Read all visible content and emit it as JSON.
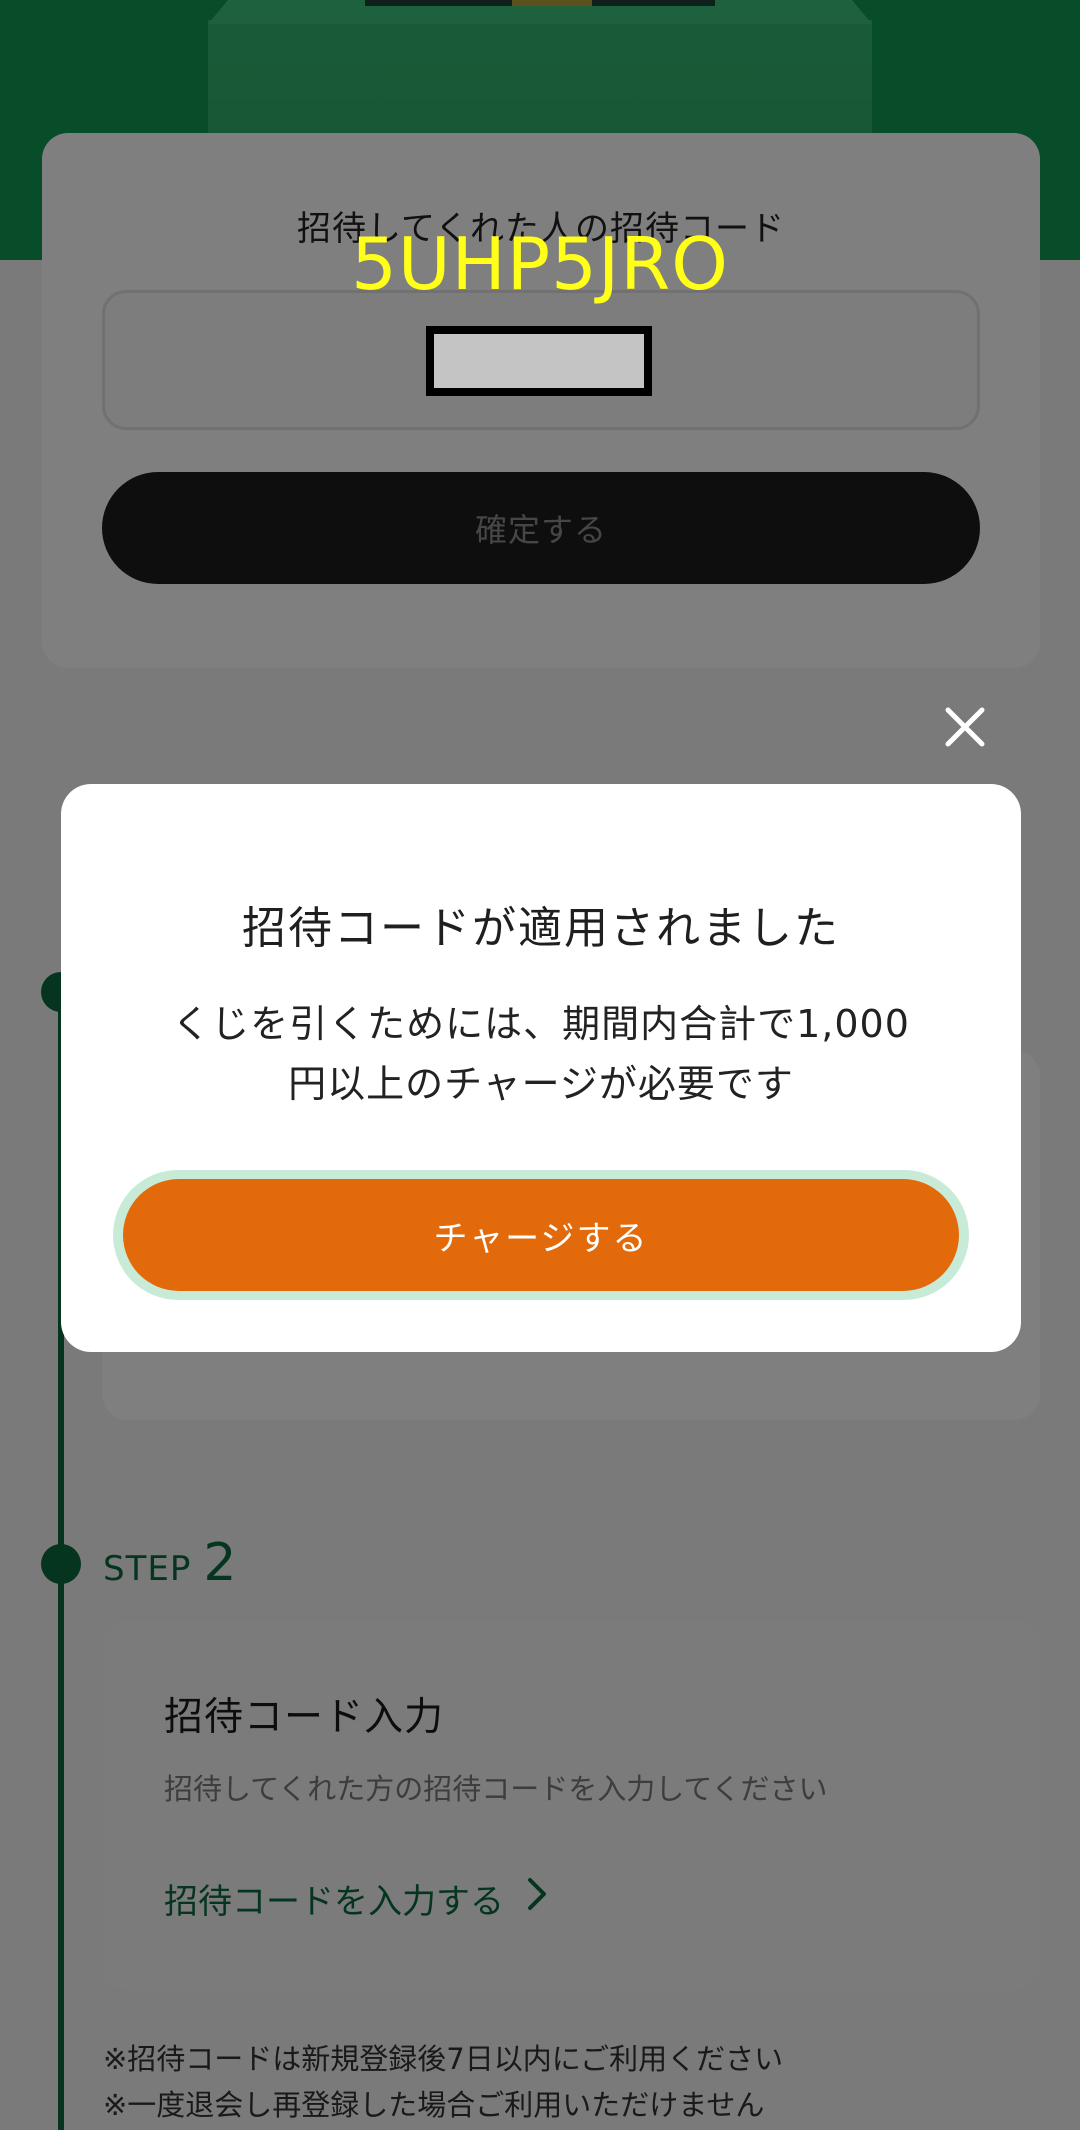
{
  "annotation": {
    "code_text": "5UHP5JRO"
  },
  "referral_section": {
    "label": "招待してくれた人の招待コード",
    "confirm_label": "確定する"
  },
  "step2": {
    "step_word": "STEP",
    "step_number": "2",
    "title": "招待コード入力",
    "description": "招待してくれた方の招待コードを入力してください",
    "link_label": "招待コードを入力する",
    "link_icon": "chevron-right-icon"
  },
  "notes": [
    "※招待コードは新規登録後7日以内にご利用ください",
    "※一度退会し再登録した場合ご利用いただけません"
  ],
  "modal": {
    "title": "招待コードが適用されました",
    "body_line1": "くじを引くためには、期間内合計で1,000",
    "body_line2": "円以上のチャージが必要です",
    "charge_label": "チャージする",
    "close_icon": "close-icon"
  },
  "colors": {
    "brand_green": "#0b6b3e",
    "hero_green": "#0e9a55",
    "charge_orange": "#e26a0b",
    "charge_glow": "#c8ebd8",
    "annotation_yellow": "#ffff1a"
  }
}
